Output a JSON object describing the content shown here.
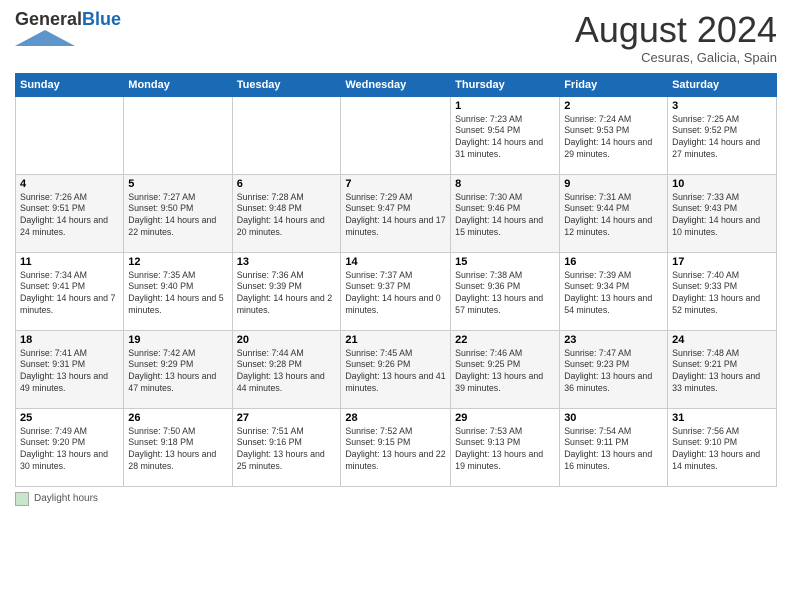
{
  "header": {
    "logo_general": "General",
    "logo_blue": "Blue",
    "month_title": "August 2024",
    "subtitle": "Cesuras, Galicia, Spain"
  },
  "days_of_week": [
    "Sunday",
    "Monday",
    "Tuesday",
    "Wednesday",
    "Thursday",
    "Friday",
    "Saturday"
  ],
  "footer": {
    "box_label": "Daylight hours"
  },
  "weeks": [
    [
      {
        "day": "",
        "info": ""
      },
      {
        "day": "",
        "info": ""
      },
      {
        "day": "",
        "info": ""
      },
      {
        "day": "",
        "info": ""
      },
      {
        "day": "1",
        "info": "Sunrise: 7:23 AM\nSunset: 9:54 PM\nDaylight: 14 hours and 31 minutes."
      },
      {
        "day": "2",
        "info": "Sunrise: 7:24 AM\nSunset: 9:53 PM\nDaylight: 14 hours and 29 minutes."
      },
      {
        "day": "3",
        "info": "Sunrise: 7:25 AM\nSunset: 9:52 PM\nDaylight: 14 hours and 27 minutes."
      }
    ],
    [
      {
        "day": "4",
        "info": "Sunrise: 7:26 AM\nSunset: 9:51 PM\nDaylight: 14 hours and 24 minutes."
      },
      {
        "day": "5",
        "info": "Sunrise: 7:27 AM\nSunset: 9:50 PM\nDaylight: 14 hours and 22 minutes."
      },
      {
        "day": "6",
        "info": "Sunrise: 7:28 AM\nSunset: 9:48 PM\nDaylight: 14 hours and 20 minutes."
      },
      {
        "day": "7",
        "info": "Sunrise: 7:29 AM\nSunset: 9:47 PM\nDaylight: 14 hours and 17 minutes."
      },
      {
        "day": "8",
        "info": "Sunrise: 7:30 AM\nSunset: 9:46 PM\nDaylight: 14 hours and 15 minutes."
      },
      {
        "day": "9",
        "info": "Sunrise: 7:31 AM\nSunset: 9:44 PM\nDaylight: 14 hours and 12 minutes."
      },
      {
        "day": "10",
        "info": "Sunrise: 7:33 AM\nSunset: 9:43 PM\nDaylight: 14 hours and 10 minutes."
      }
    ],
    [
      {
        "day": "11",
        "info": "Sunrise: 7:34 AM\nSunset: 9:41 PM\nDaylight: 14 hours and 7 minutes."
      },
      {
        "day": "12",
        "info": "Sunrise: 7:35 AM\nSunset: 9:40 PM\nDaylight: 14 hours and 5 minutes."
      },
      {
        "day": "13",
        "info": "Sunrise: 7:36 AM\nSunset: 9:39 PM\nDaylight: 14 hours and 2 minutes."
      },
      {
        "day": "14",
        "info": "Sunrise: 7:37 AM\nSunset: 9:37 PM\nDaylight: 14 hours and 0 minutes."
      },
      {
        "day": "15",
        "info": "Sunrise: 7:38 AM\nSunset: 9:36 PM\nDaylight: 13 hours and 57 minutes."
      },
      {
        "day": "16",
        "info": "Sunrise: 7:39 AM\nSunset: 9:34 PM\nDaylight: 13 hours and 54 minutes."
      },
      {
        "day": "17",
        "info": "Sunrise: 7:40 AM\nSunset: 9:33 PM\nDaylight: 13 hours and 52 minutes."
      }
    ],
    [
      {
        "day": "18",
        "info": "Sunrise: 7:41 AM\nSunset: 9:31 PM\nDaylight: 13 hours and 49 minutes."
      },
      {
        "day": "19",
        "info": "Sunrise: 7:42 AM\nSunset: 9:29 PM\nDaylight: 13 hours and 47 minutes."
      },
      {
        "day": "20",
        "info": "Sunrise: 7:44 AM\nSunset: 9:28 PM\nDaylight: 13 hours and 44 minutes."
      },
      {
        "day": "21",
        "info": "Sunrise: 7:45 AM\nSunset: 9:26 PM\nDaylight: 13 hours and 41 minutes."
      },
      {
        "day": "22",
        "info": "Sunrise: 7:46 AM\nSunset: 9:25 PM\nDaylight: 13 hours and 39 minutes."
      },
      {
        "day": "23",
        "info": "Sunrise: 7:47 AM\nSunset: 9:23 PM\nDaylight: 13 hours and 36 minutes."
      },
      {
        "day": "24",
        "info": "Sunrise: 7:48 AM\nSunset: 9:21 PM\nDaylight: 13 hours and 33 minutes."
      }
    ],
    [
      {
        "day": "25",
        "info": "Sunrise: 7:49 AM\nSunset: 9:20 PM\nDaylight: 13 hours and 30 minutes."
      },
      {
        "day": "26",
        "info": "Sunrise: 7:50 AM\nSunset: 9:18 PM\nDaylight: 13 hours and 28 minutes."
      },
      {
        "day": "27",
        "info": "Sunrise: 7:51 AM\nSunset: 9:16 PM\nDaylight: 13 hours and 25 minutes."
      },
      {
        "day": "28",
        "info": "Sunrise: 7:52 AM\nSunset: 9:15 PM\nDaylight: 13 hours and 22 minutes."
      },
      {
        "day": "29",
        "info": "Sunrise: 7:53 AM\nSunset: 9:13 PM\nDaylight: 13 hours and 19 minutes."
      },
      {
        "day": "30",
        "info": "Sunrise: 7:54 AM\nSunset: 9:11 PM\nDaylight: 13 hours and 16 minutes."
      },
      {
        "day": "31",
        "info": "Sunrise: 7:56 AM\nSunset: 9:10 PM\nDaylight: 13 hours and 14 minutes."
      }
    ]
  ]
}
